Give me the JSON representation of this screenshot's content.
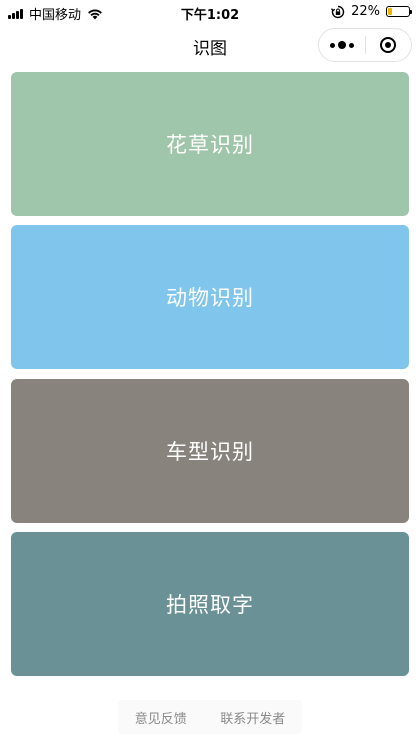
{
  "status_bar": {
    "carrier": "中国移动",
    "time": "下午1:02",
    "battery_percent": "22%",
    "battery_level": 0.22,
    "battery_color": "#f2b200"
  },
  "nav": {
    "title": "识图",
    "more_icon": "more-dots-icon",
    "close_icon": "target-icon"
  },
  "cards": [
    {
      "label": "花草识别",
      "color": "#9fc5aa"
    },
    {
      "label": "动物识别",
      "color": "#7fc5ec"
    },
    {
      "label": "车型识别",
      "color": "#88837d"
    },
    {
      "label": "拍照取字",
      "color": "#6a9195"
    }
  ],
  "footer": {
    "feedback_label": "意见反馈",
    "contact_label": "联系开发者"
  }
}
